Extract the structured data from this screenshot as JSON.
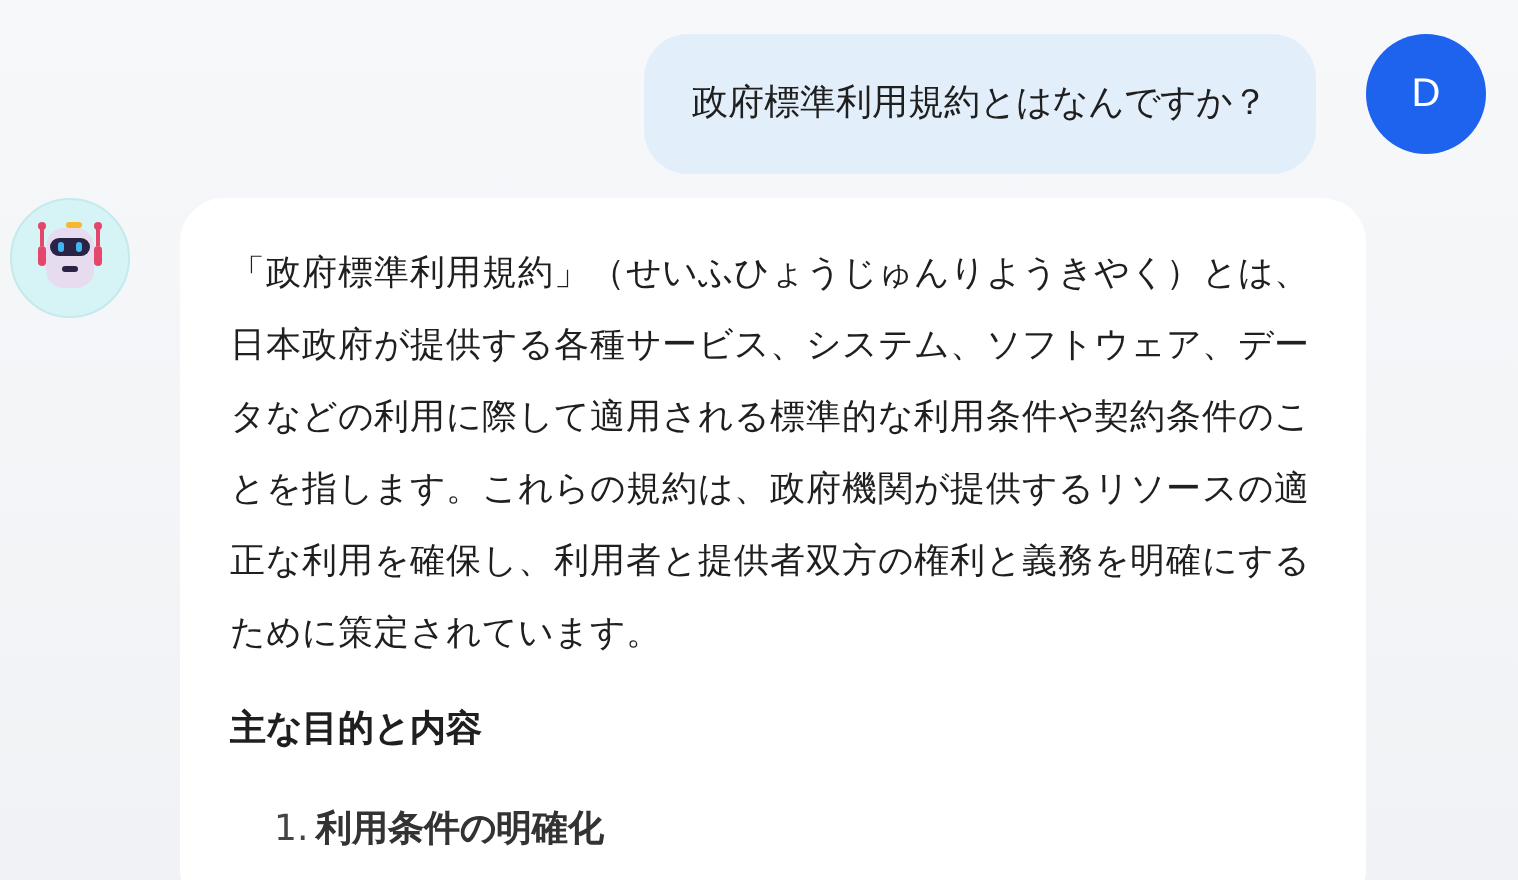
{
  "messages": [
    {
      "kind": "user",
      "avatar": "D",
      "text": "政府標準利用規約とはなんですか？"
    },
    {
      "kind": "assistant",
      "paragraph": "「政府標準利用規約」（せいふひょうじゅんりようきやく）とは、日本政府が提供する各種サービス、システム、ソフトウェア、データなどの利用に際して適用される標準的な利用条件や契約条件のことを指します。これらの規約は、政府機関が提供するリソースの適正な利用を確保し、利用者と提供者双方の権利と義務を明確にするために策定されています。",
      "heading": "主な目的と内容",
      "list": [
        {
          "marker": "1.",
          "title": "利用条件の明確化"
        }
      ]
    }
  ]
}
